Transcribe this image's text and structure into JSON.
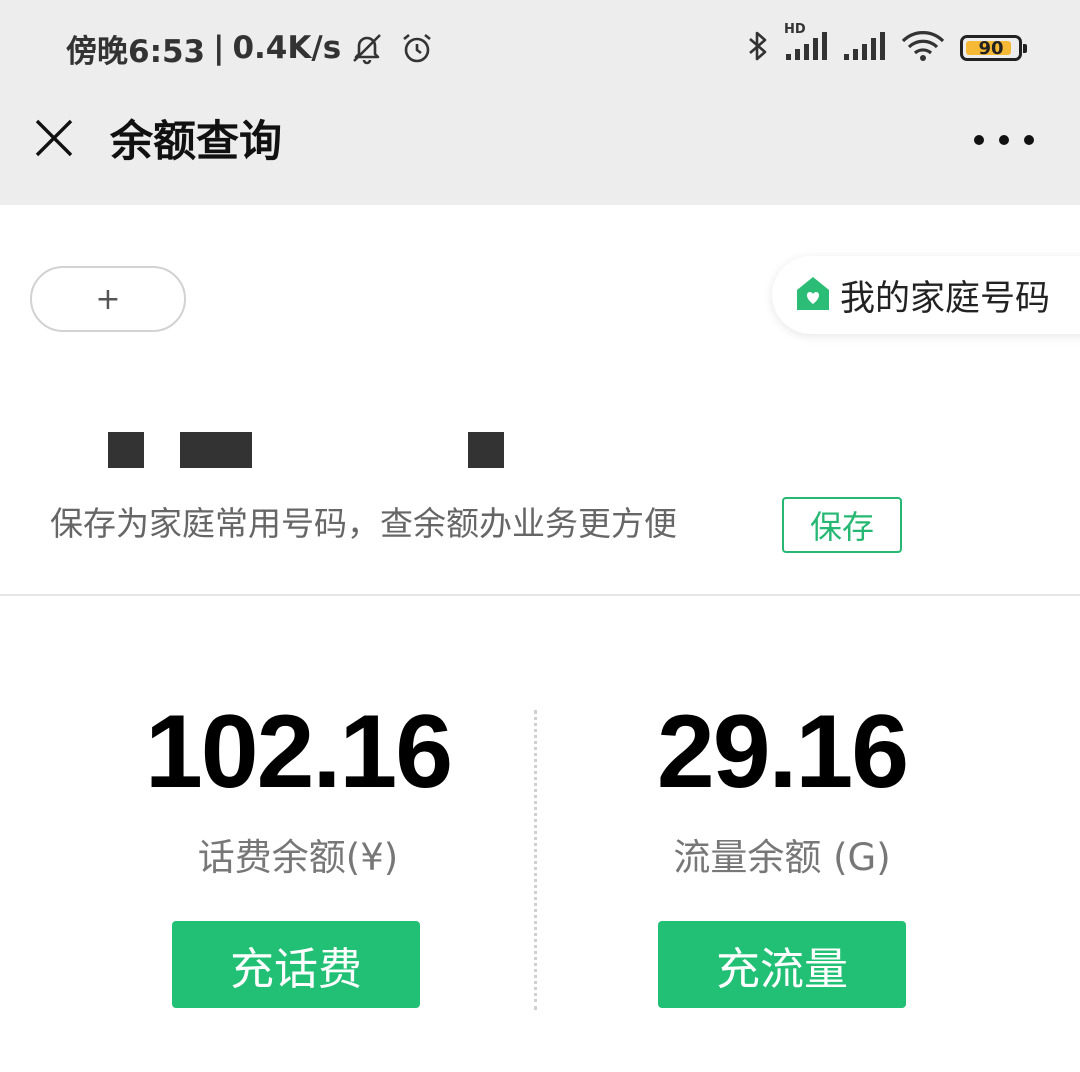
{
  "status_bar": {
    "time": "傍晚6:53",
    "separator": "|",
    "net_speed": "0.4K/s",
    "network_badge": "HD",
    "battery_level": "90",
    "icons": [
      "bell-muted-icon",
      "alarm-clock-icon",
      "bluetooth-icon",
      "signal-icon",
      "wifi-icon",
      "battery-icon"
    ],
    "battery_fill_fraction": 0.9,
    "battery_color": "#f5b935"
  },
  "nav": {
    "title": "余额查询",
    "close_icon": "close-icon",
    "more_icon": "more-icon"
  },
  "add_number": {
    "label": "+"
  },
  "family": {
    "label": "我的家庭号码",
    "icon": "home-heart-icon",
    "icon_color": "#2bbd75"
  },
  "save_prompt": {
    "text": "保存为家庭常用号码，查余额办业务更方便",
    "button": "保存"
  },
  "balances": {
    "phone": {
      "value": "102.16",
      "label": "话费余额(¥)",
      "button": "充话费"
    },
    "data": {
      "value": "29.16",
      "label": "流量余额 (G)",
      "button": "充流量"
    }
  },
  "colors": {
    "accent": "#22c075",
    "header_bg": "#ededed"
  }
}
